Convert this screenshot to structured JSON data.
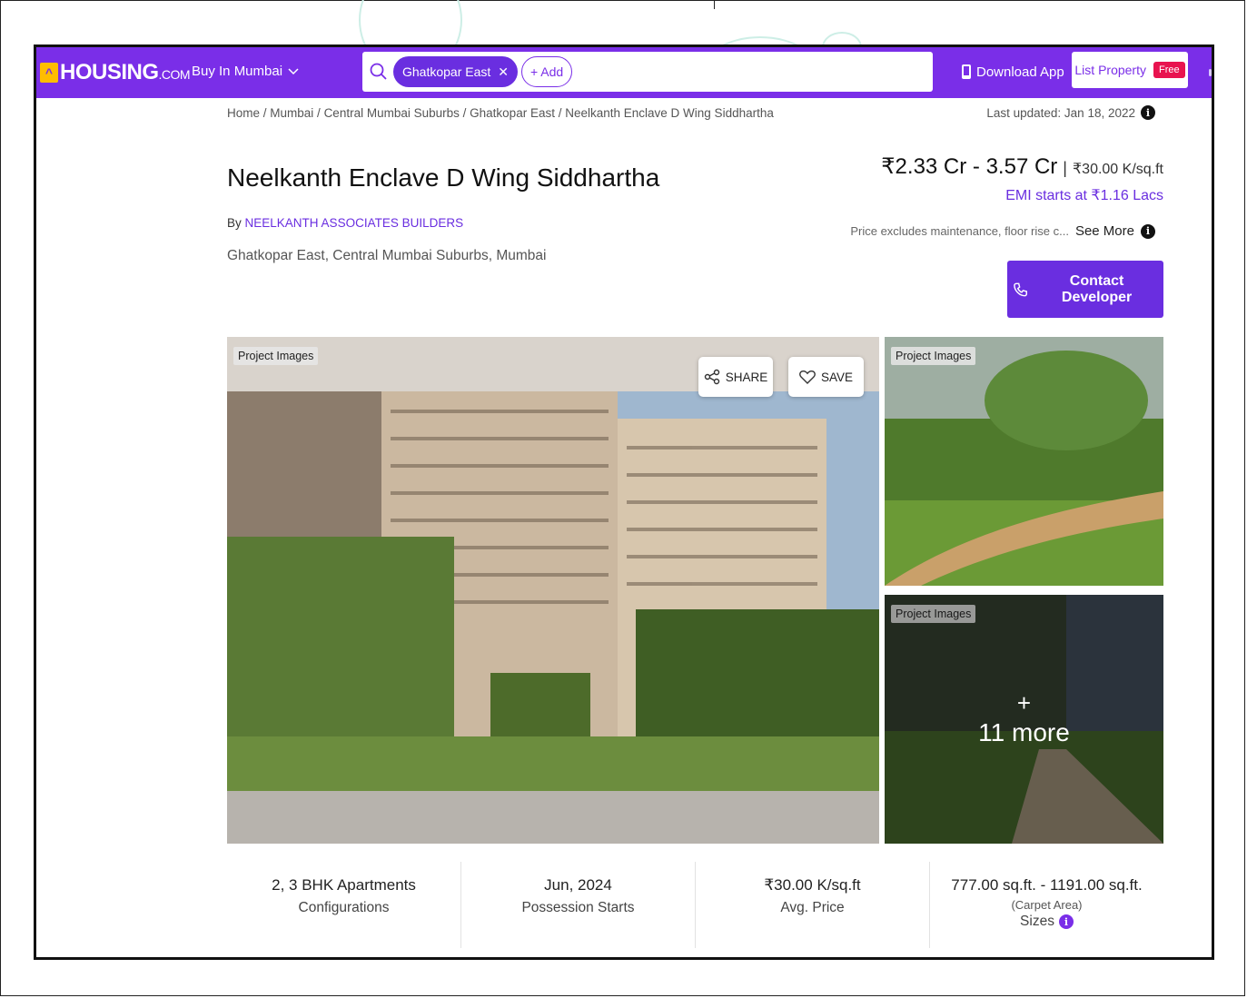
{
  "header": {
    "logo_text": "HOUSING",
    "logo_suffix": ".COM",
    "city_select": "Buy In Mumbai",
    "search_chip": "Ghatkopar East",
    "add_label": "+ Add",
    "download_app": "Download App",
    "list_property": "List Property",
    "free_badge": "Free"
  },
  "breadcrumb": [
    "Home",
    "Mumbai",
    "Central Mumbai Suburbs",
    "Ghatkopar East",
    "Neelkanth Enclave D Wing Siddhartha"
  ],
  "last_updated": "Last updated: Jan 18, 2022",
  "project": {
    "title": "Neelkanth Enclave D Wing Siddhartha",
    "by_prefix": "By",
    "builder": "NEELKANTH ASSOCIATES BUILDERS",
    "location": "Ghatkopar East, Central Mumbai Suburbs, Mumbai"
  },
  "pricing": {
    "range": "₹2.33 Cr - 3.57 Cr",
    "separator": "|",
    "per_sqft": "₹30.00 K/sq.ft",
    "emi": "EMI starts at ₹1.16 Lacs",
    "note": "Price excludes maintenance, floor rise c...",
    "see_more": "See More"
  },
  "contact_button": "Contact Developer",
  "gallery": {
    "tag": "Project Images",
    "share": "SHARE",
    "save": "SAVE",
    "more_plus": "+",
    "more_count": "11 more"
  },
  "stats": [
    {
      "value": "2, 3 BHK Apartments",
      "label": "Configurations"
    },
    {
      "value": "Jun, 2024",
      "label": "Possession Starts"
    },
    {
      "value": "₹30.00 K/sq.ft",
      "label": "Avg. Price"
    },
    {
      "value": "777.00 sq.ft. - 1191.00 sq.ft.",
      "sub": "(Carpet Area)",
      "label": "Sizes"
    }
  ],
  "colors": {
    "brand_purple": "#7a2ee8",
    "logo_yellow": "#ffbd00",
    "free_badge": "#e8134f"
  }
}
